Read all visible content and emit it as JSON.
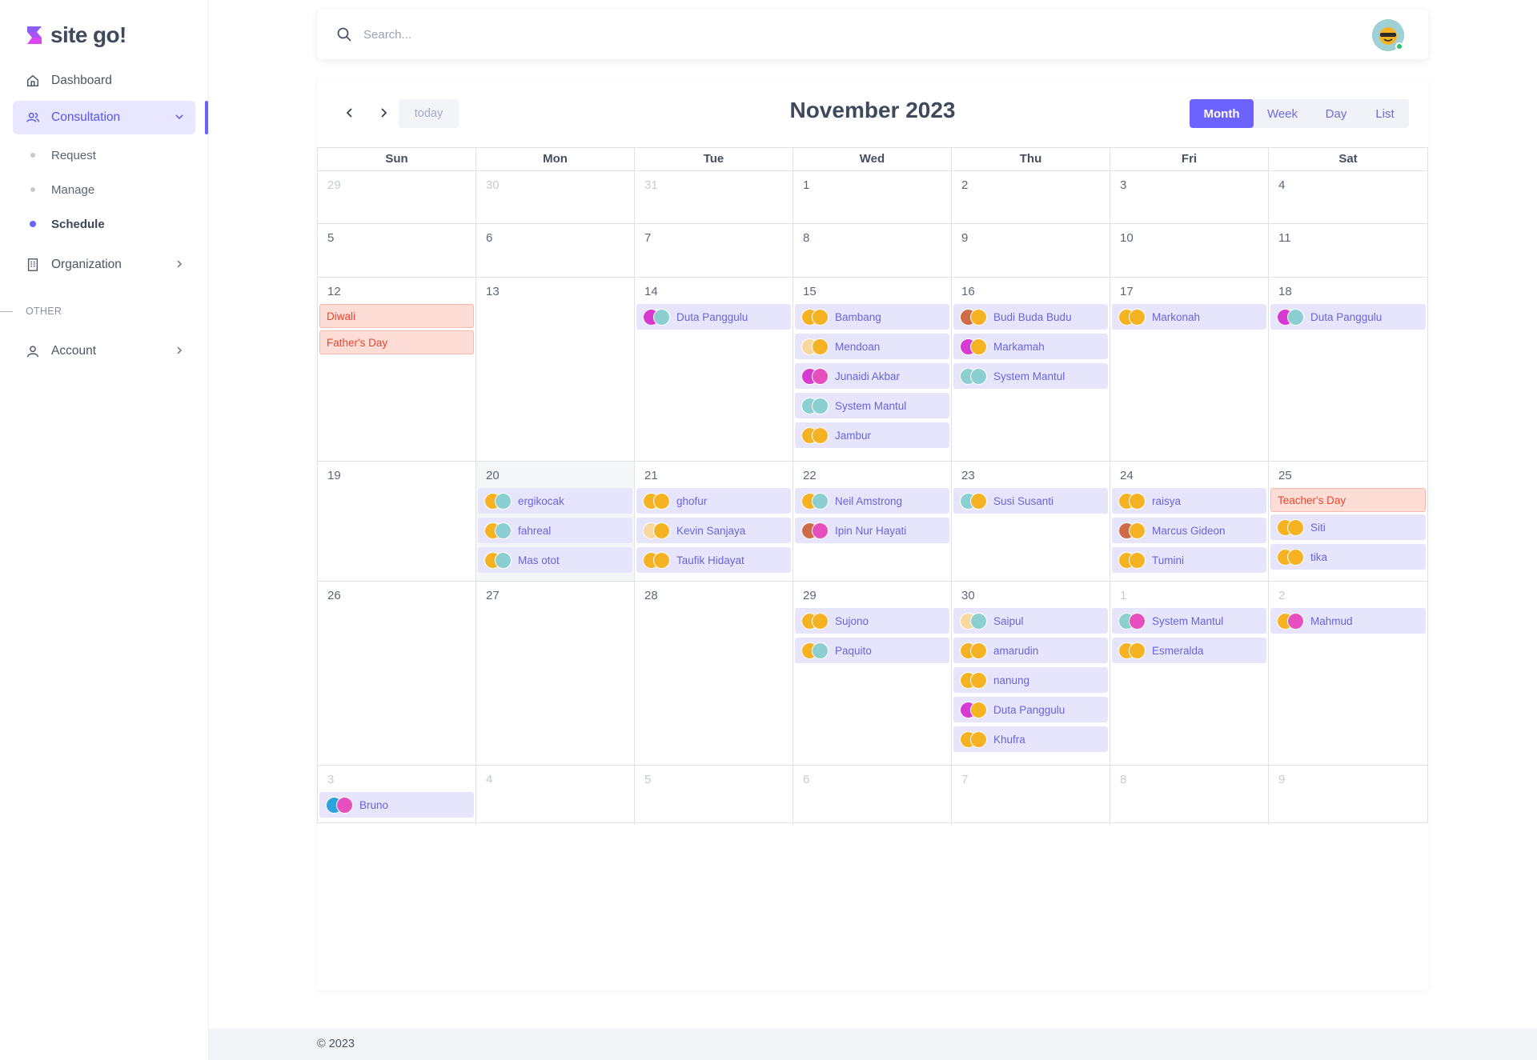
{
  "brand": {
    "name": "site go!"
  },
  "sidebar": {
    "dashboard": "Dashboard",
    "consultation": "Consultation",
    "sub": [
      "Request",
      "Manage",
      "Schedule"
    ],
    "organization": "Organization",
    "other_label": "OTHER",
    "account": "Account"
  },
  "search": {
    "placeholder": "Search..."
  },
  "calendar": {
    "title": "November 2023",
    "today": "today",
    "views": [
      "Month",
      "Week",
      "Day",
      "List"
    ],
    "active_view": "Month",
    "weekdays": [
      "Sun",
      "Mon",
      "Tue",
      "Wed",
      "Thu",
      "Fri",
      "Sat"
    ],
    "today_date": "2023-11-20",
    "weeks": [
      {
        "days": [
          {
            "n": "29",
            "other": true,
            "events": []
          },
          {
            "n": "30",
            "other": true,
            "events": []
          },
          {
            "n": "31",
            "other": true,
            "events": []
          },
          {
            "n": "1",
            "events": []
          },
          {
            "n": "2",
            "events": []
          },
          {
            "n": "3",
            "events": []
          },
          {
            "n": "4",
            "events": []
          }
        ]
      },
      {
        "days": [
          {
            "n": "5",
            "events": []
          },
          {
            "n": "6",
            "events": []
          },
          {
            "n": "7",
            "events": []
          },
          {
            "n": "8",
            "events": []
          },
          {
            "n": "9",
            "events": []
          },
          {
            "n": "10",
            "events": []
          },
          {
            "n": "11",
            "events": []
          }
        ]
      },
      {
        "days": [
          {
            "n": "12",
            "events": [
              {
                "title": "Diwali",
                "holiday": true
              },
              {
                "title": "Father's Day",
                "holiday": true
              }
            ]
          },
          {
            "n": "13",
            "events": []
          },
          {
            "n": "14",
            "events": [
              {
                "title": "Duta Panggulu",
                "avatars": [
                  "#d63ad0",
                  "#8ccfd1"
                ]
              }
            ]
          },
          {
            "n": "15",
            "events": [
              {
                "title": "Bambang",
                "avatars": [
                  "#f5b324",
                  "#f5b324"
                ]
              },
              {
                "title": "Mendoan",
                "avatars": [
                  "#f7d9a0",
                  "#f5b324"
                ]
              },
              {
                "title": "Junaidi Akbar",
                "avatars": [
                  "#d63ad0",
                  "#e64fbe"
                ]
              },
              {
                "title": "System Mantul",
                "avatars": [
                  "#8ccfd1",
                  "#8ccfd1"
                ]
              },
              {
                "title": "Jambur",
                "avatars": [
                  "#f5b324",
                  "#f5b324"
                ]
              }
            ]
          },
          {
            "n": "16",
            "events": [
              {
                "title": "Budi Buda Budu",
                "avatars": [
                  "#d06b4a",
                  "#f5b324"
                ]
              },
              {
                "title": "Markamah",
                "avatars": [
                  "#d63ad0",
                  "#f5b324"
                ]
              },
              {
                "title": "System Mantul",
                "avatars": [
                  "#8ccfd1",
                  "#8ccfd1"
                ]
              }
            ]
          },
          {
            "n": "17",
            "events": [
              {
                "title": "Markonah",
                "avatars": [
                  "#f5b324",
                  "#f5b324"
                ]
              }
            ]
          },
          {
            "n": "18",
            "events": [
              {
                "title": "Duta Panggulu",
                "avatars": [
                  "#d63ad0",
                  "#8ccfd1"
                ]
              }
            ]
          }
        ]
      },
      {
        "days": [
          {
            "n": "19",
            "events": []
          },
          {
            "n": "20",
            "today": true,
            "events": [
              {
                "title": "ergikocak",
                "avatars": [
                  "#f5b324",
                  "#8ccfd1"
                ]
              },
              {
                "title": "fahreal",
                "avatars": [
                  "#f5b324",
                  "#8ccfd1"
                ]
              },
              {
                "title": "Mas otot",
                "avatars": [
                  "#f5b324",
                  "#8ccfd1"
                ]
              }
            ]
          },
          {
            "n": "21",
            "events": [
              {
                "title": "ghofur",
                "avatars": [
                  "#f5b324",
                  "#f5b324"
                ]
              },
              {
                "title": "Kevin Sanjaya",
                "avatars": [
                  "#f7d9a0",
                  "#f5b324"
                ]
              },
              {
                "title": "Taufik Hidayat",
                "avatars": [
                  "#f5b324",
                  "#f5b324"
                ]
              }
            ]
          },
          {
            "n": "22",
            "events": [
              {
                "title": "Neil Amstrong",
                "avatars": [
                  "#f5b324",
                  "#8ccfd1"
                ]
              },
              {
                "title": "Ipin Nur Hayati",
                "avatars": [
                  "#d06b4a",
                  "#e64fbe"
                ]
              }
            ]
          },
          {
            "n": "23",
            "events": [
              {
                "title": "Susi Susanti",
                "avatars": [
                  "#8ccfd1",
                  "#f5b324"
                ]
              }
            ]
          },
          {
            "n": "24",
            "events": [
              {
                "title": "raisya",
                "avatars": [
                  "#f5b324",
                  "#f5b324"
                ]
              },
              {
                "title": "Marcus Gideon",
                "avatars": [
                  "#d06b4a",
                  "#f5b324"
                ]
              },
              {
                "title": "Tumini",
                "avatars": [
                  "#f5b324",
                  "#f5b324"
                ]
              }
            ]
          },
          {
            "n": "25",
            "events": [
              {
                "title": "Teacher's Day",
                "holiday": true
              },
              {
                "title": "Siti",
                "avatars": [
                  "#f5b324",
                  "#f5b324"
                ]
              },
              {
                "title": "tika",
                "avatars": [
                  "#f5b324",
                  "#f5b324"
                ]
              }
            ]
          }
        ]
      },
      {
        "days": [
          {
            "n": "26",
            "events": []
          },
          {
            "n": "27",
            "events": []
          },
          {
            "n": "28",
            "events": []
          },
          {
            "n": "29",
            "events": [
              {
                "title": "Sujono",
                "avatars": [
                  "#f5b324",
                  "#f5b324"
                ]
              },
              {
                "title": "Paquito",
                "avatars": [
                  "#f5b324",
                  "#8ccfd1"
                ]
              }
            ]
          },
          {
            "n": "30",
            "events": [
              {
                "title": "Saipul",
                "avatars": [
                  "#f7d9a0",
                  "#8ccfd1"
                ]
              },
              {
                "title": "amarudin",
                "avatars": [
                  "#f5b324",
                  "#f5b324"
                ]
              },
              {
                "title": "nanung",
                "avatars": [
                  "#f5b324",
                  "#f5b324"
                ]
              },
              {
                "title": "Duta Panggulu",
                "avatars": [
                  "#d63ad0",
                  "#f5b324"
                ]
              },
              {
                "title": "Khufra",
                "avatars": [
                  "#f5b324",
                  "#f5b324"
                ]
              }
            ]
          },
          {
            "n": "1",
            "other": true,
            "events": [
              {
                "title": "System Mantul",
                "avatars": [
                  "#8ccfd1",
                  "#e64fbe"
                ]
              },
              {
                "title": "Esmeralda",
                "avatars": [
                  "#f5b324",
                  "#f5b324"
                ]
              }
            ]
          },
          {
            "n": "2",
            "other": true,
            "events": [
              {
                "title": "Mahmud",
                "avatars": [
                  "#f5b324",
                  "#e64fbe"
                ]
              }
            ]
          }
        ]
      },
      {
        "days": [
          {
            "n": "3",
            "other": true,
            "events": [
              {
                "title": "Bruno",
                "avatars": [
                  "#2aa3e0",
                  "#e64fbe"
                ]
              }
            ]
          },
          {
            "n": "4",
            "other": true,
            "events": []
          },
          {
            "n": "5",
            "other": true,
            "events": []
          },
          {
            "n": "6",
            "other": true,
            "events": []
          },
          {
            "n": "7",
            "other": true,
            "events": []
          },
          {
            "n": "8",
            "other": true,
            "events": []
          },
          {
            "n": "9",
            "other": true,
            "events": []
          }
        ]
      }
    ]
  },
  "footer": {
    "copyright": "© 2023"
  },
  "colors": {
    "accent": "#6c63ff",
    "event_bg": "#e6e5fc",
    "event_text": "#6b63d9",
    "holiday_bg": "#fdddd6",
    "holiday_text": "#e8472f"
  },
  "icons": [
    "logo-mark",
    "home-icon",
    "users-icon",
    "chevron-down-icon",
    "building-icon",
    "chevron-right-icon",
    "user-icon",
    "search-icon",
    "chevron-left-icon",
    "avatar"
  ]
}
